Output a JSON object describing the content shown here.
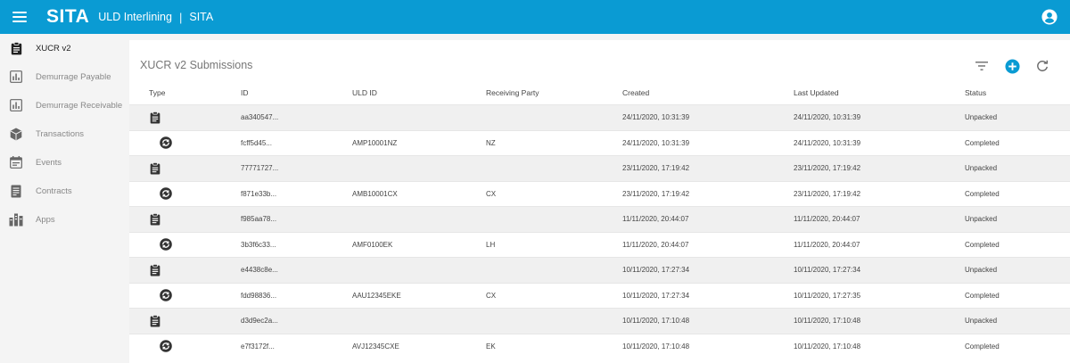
{
  "header": {
    "logo": "SITA",
    "app_title": "ULD Interlining",
    "separator": "|",
    "org": "SITA"
  },
  "sidebar": {
    "items": [
      {
        "label": "XUCR v2",
        "icon": "clipboard-icon",
        "active": true
      },
      {
        "label": "Demurrage Payable",
        "icon": "chart-icon",
        "active": false
      },
      {
        "label": "Demurrage Receivable",
        "icon": "chart-icon",
        "active": false
      },
      {
        "label": "Transactions",
        "icon": "cube-icon",
        "active": false
      },
      {
        "label": "Events",
        "icon": "calendar-icon",
        "active": false
      },
      {
        "label": "Contracts",
        "icon": "document-icon",
        "active": false
      },
      {
        "label": "Apps",
        "icon": "apps-icon",
        "active": false
      }
    ]
  },
  "main": {
    "title": "XUCR v2 Submissions",
    "tools": [
      "filter-icon",
      "add-icon",
      "refresh-icon"
    ],
    "table": {
      "columns": [
        "Type",
        "ID",
        "ULD ID",
        "Receiving Party",
        "Created",
        "Last Updated",
        "Status"
      ],
      "rows": [
        {
          "type": "clipboard",
          "id": "aa340547...",
          "uld": "",
          "party": "",
          "created": "24/11/2020, 10:31:39",
          "updated": "24/11/2020, 10:31:39",
          "status": "Unpacked"
        },
        {
          "type": "sync",
          "id": "fcff5d45...",
          "uld": "AMP10001NZ",
          "party": "NZ",
          "created": "24/11/2020, 10:31:39",
          "updated": "24/11/2020, 10:31:39",
          "status": "Completed"
        },
        {
          "type": "clipboard",
          "id": "77771727...",
          "uld": "",
          "party": "",
          "created": "23/11/2020, 17:19:42",
          "updated": "23/11/2020, 17:19:42",
          "status": "Unpacked"
        },
        {
          "type": "sync",
          "id": "f871e33b...",
          "uld": "AMB10001CX",
          "party": "CX",
          "created": "23/11/2020, 17:19:42",
          "updated": "23/11/2020, 17:19:42",
          "status": "Completed"
        },
        {
          "type": "clipboard",
          "id": "f985aa78...",
          "uld": "",
          "party": "",
          "created": "11/11/2020, 20:44:07",
          "updated": "11/11/2020, 20:44:07",
          "status": "Unpacked"
        },
        {
          "type": "sync",
          "id": "3b3f6c33...",
          "uld": "AMF0100EK",
          "party": "LH",
          "created": "11/11/2020, 20:44:07",
          "updated": "11/11/2020, 20:44:07",
          "status": "Completed"
        },
        {
          "type": "clipboard",
          "id": "e4438c8e...",
          "uld": "",
          "party": "",
          "created": "10/11/2020, 17:27:34",
          "updated": "10/11/2020, 17:27:34",
          "status": "Unpacked"
        },
        {
          "type": "sync",
          "id": "fdd98836...",
          "uld": "AAU12345EKE",
          "party": "CX",
          "created": "10/11/2020, 17:27:34",
          "updated": "10/11/2020, 17:27:35",
          "status": "Completed"
        },
        {
          "type": "clipboard",
          "id": "d3d9ec2a...",
          "uld": "",
          "party": "",
          "created": "10/11/2020, 17:10:48",
          "updated": "10/11/2020, 17:10:48",
          "status": "Unpacked"
        },
        {
          "type": "sync",
          "id": "e7f3172f...",
          "uld": "AVJ12345CXE",
          "party": "EK",
          "created": "10/11/2020, 17:10:48",
          "updated": "10/11/2020, 17:10:48",
          "status": "Completed"
        }
      ]
    }
  },
  "colors": {
    "header_bg": "#0a9bd3",
    "accent": "#0a9bd3",
    "row_shade": "#f0f0f0"
  }
}
